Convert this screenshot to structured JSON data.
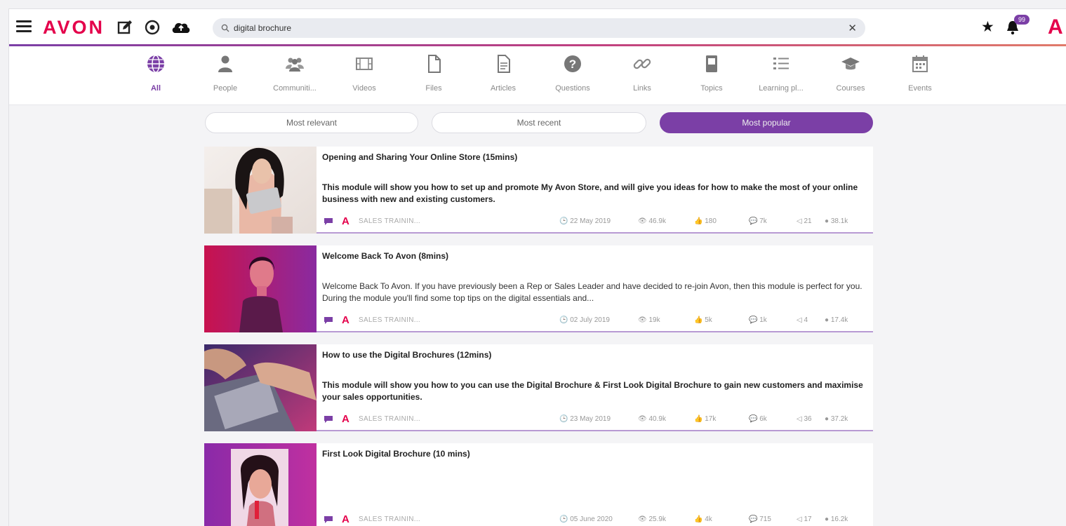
{
  "brand": "AVON",
  "search": {
    "value": "digital brochure",
    "placeholder": ""
  },
  "notifications": {
    "badge": "99"
  },
  "categories": [
    {
      "label": "All",
      "icon": "globe-icon"
    },
    {
      "label": "People",
      "icon": "person-icon"
    },
    {
      "label": "Communiti...",
      "icon": "group-icon"
    },
    {
      "label": "Videos",
      "icon": "film-icon"
    },
    {
      "label": "Files",
      "icon": "file-icon"
    },
    {
      "label": "Articles",
      "icon": "article-icon"
    },
    {
      "label": "Questions",
      "icon": "question-icon"
    },
    {
      "label": "Links",
      "icon": "link-icon"
    },
    {
      "label": "Topics",
      "icon": "book-icon"
    },
    {
      "label": "Learning pl...",
      "icon": "list-icon"
    },
    {
      "label": "Courses",
      "icon": "graduation-cap-icon"
    },
    {
      "label": "Events",
      "icon": "calendar-icon"
    }
  ],
  "sort": {
    "relevant": "Most relevant",
    "recent": "Most recent",
    "popular": "Most popular"
  },
  "accent": "#7b3fa6",
  "brand_color": "#e4004b",
  "results": [
    {
      "title": "Opening and Sharing Your Online Store (15mins)",
      "description": "This module will show you how to set up and promote My Avon Store, and will give you ideas for how to make the most of your online business with new and existing customers.",
      "category": "SALES TRAININ...",
      "date": "22 May 2019",
      "views": "46.9k",
      "likes": "180",
      "comments": "7k",
      "shares": "21",
      "completions": "38.1k"
    },
    {
      "title": "Welcome Back To Avon (8mins)",
      "description": "Welcome Back To Avon. If you have previously been a Rep or Sales Leader and have decided to re-join Avon, then this module is perfect for you. During the module you'll find some top tips on the digital essentials and...",
      "category": "SALES TRAININ...",
      "date": "02 July 2019",
      "views": "19k",
      "likes": "5k",
      "comments": "1k",
      "shares": "4",
      "completions": "17.4k"
    },
    {
      "title": "How to use the Digital Brochures (12mins)",
      "description": "This module will show you how to you can use the Digital Brochure & First Look Digital Brochure to gain new customers and maximise your sales opportunities.",
      "category": "SALES TRAININ...",
      "date": "23 May 2019",
      "views": "40.9k",
      "likes": "17k",
      "comments": "6k",
      "shares": "36",
      "completions": "37.2k"
    },
    {
      "title": "First Look Digital Brochure (10 mins)",
      "description": "",
      "category": "SALES TRAININ...",
      "date": "05 June 2020",
      "views": "25.9k",
      "likes": "4k",
      "comments": "715",
      "shares": "17",
      "completions": "16.2k"
    }
  ]
}
